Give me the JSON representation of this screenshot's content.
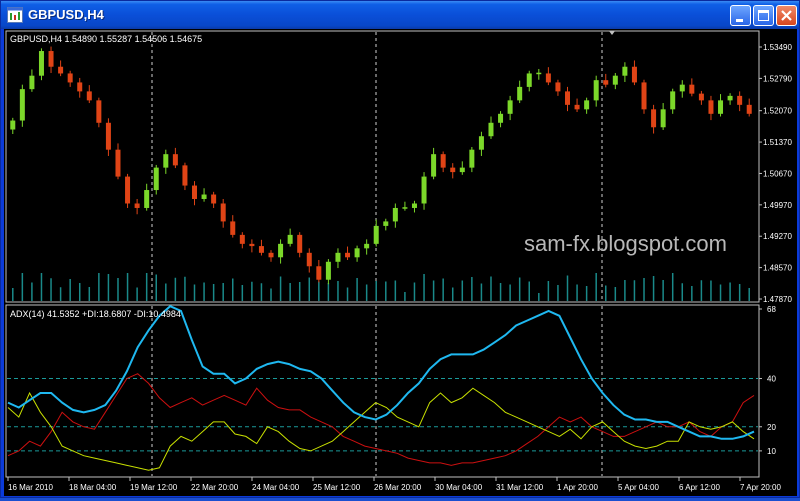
{
  "window": {
    "title": "GBPUSD,H4",
    "buttons": [
      "minimize",
      "maximize",
      "close"
    ]
  },
  "chart_data": [
    {
      "type": "candlestick",
      "title": "GBPUSD,H4  1.54890 1.55287 1.54506 1.54675",
      "symbol": "GBPUSD",
      "timeframe": "H4",
      "ohlc_header": {
        "open": "1.54890",
        "high": "1.55287",
        "low": "1.54506",
        "close": "1.54675"
      },
      "y_ticks": [
        "1.53490",
        "1.52790",
        "1.52070",
        "1.51370",
        "1.50670",
        "1.49970",
        "1.49270",
        "1.48570",
        "1.47870"
      ],
      "ylim": [
        1.4787,
        1.5349
      ],
      "close_path": [
        1.5185,
        1.5255,
        1.5285,
        1.534,
        1.5305,
        1.529,
        1.527,
        1.525,
        1.523,
        1.518,
        1.512,
        1.506,
        1.5,
        1.499,
        1.503,
        1.508,
        1.511,
        1.5085,
        1.504,
        1.501,
        1.502,
        1.5,
        1.496,
        1.493,
        1.491,
        1.4905,
        1.489,
        1.488,
        1.491,
        1.493,
        1.489,
        1.486,
        1.483,
        1.487,
        1.489,
        1.488,
        1.49,
        1.491,
        1.495,
        1.496,
        1.499,
        1.499,
        1.5,
        1.506,
        1.511,
        1.508,
        1.507,
        1.508,
        1.512,
        1.515,
        1.518,
        1.52,
        1.523,
        1.526,
        1.529,
        1.529,
        1.527,
        1.525,
        1.522,
        1.521,
        1.523,
        1.5275,
        1.5265,
        1.5285,
        1.5305,
        1.527,
        1.521,
        1.517,
        1.521,
        1.525,
        1.5265,
        1.5245,
        1.523,
        1.52,
        1.523,
        1.524,
        1.522,
        1.52
      ],
      "watermark": "sam-fx.blogspot.com"
    },
    {
      "type": "line",
      "title": "ADX(14) 41.5352 +DI:18.6807 -DI:10.4984",
      "indicator": "ADX(14)",
      "values": {
        "adx": "41.5352",
        "plus_di": "18.6807",
        "minus_di": "10.4984"
      },
      "y_ticks": [
        "68",
        "40",
        "20",
        "10"
      ],
      "levels": [
        40,
        20,
        10
      ],
      "ylim": [
        0,
        68
      ],
      "series": [
        {
          "name": "ADX",
          "color": "#1fb8f0",
          "values": [
            30,
            28,
            31,
            34,
            34,
            30,
            27,
            26,
            27,
            29,
            35,
            43,
            53,
            60,
            66,
            70,
            68,
            56,
            45,
            42,
            42,
            38,
            40,
            44,
            46,
            47,
            46,
            44,
            43,
            40,
            35,
            30,
            26,
            24,
            23,
            25,
            29,
            34,
            38,
            44,
            48,
            50,
            50,
            50,
            52,
            55,
            58,
            62,
            64,
            66,
            68,
            66,
            57,
            48,
            40,
            34,
            29,
            25,
            23,
            23,
            22,
            22,
            20,
            18,
            16,
            16,
            15,
            15,
            16,
            18
          ]
        },
        {
          "name": "+DI",
          "color": "#c8e000",
          "values": [
            28,
            24,
            34,
            26,
            20,
            12,
            10,
            8,
            7,
            6,
            5,
            4,
            3,
            2,
            3,
            12,
            16,
            14,
            18,
            22,
            22,
            17,
            16,
            13,
            20,
            18,
            14,
            11,
            10,
            12,
            14,
            18,
            22,
            26,
            30,
            28,
            24,
            22,
            20,
            30,
            34,
            30,
            32,
            36,
            33,
            30,
            26,
            24,
            22,
            20,
            18,
            16,
            19,
            15,
            20,
            22,
            18,
            14,
            12,
            11,
            12,
            14,
            14,
            22,
            20,
            19,
            20,
            22,
            18,
            15
          ]
        },
        {
          "name": "-DI",
          "color": "#cc1010",
          "values": [
            8,
            10,
            14,
            12,
            18,
            26,
            22,
            20,
            19,
            26,
            33,
            40,
            42,
            38,
            32,
            28,
            30,
            32,
            29,
            31,
            33,
            31,
            29,
            36,
            31,
            28,
            27,
            27,
            24,
            22,
            20,
            16,
            14,
            12,
            11,
            10,
            9,
            7,
            6,
            5,
            5,
            4,
            5,
            5,
            6,
            7,
            8,
            10,
            13,
            16,
            20,
            24,
            22,
            24,
            20,
            18,
            16,
            16,
            18,
            20,
            22,
            20,
            20,
            22,
            18,
            16,
            20,
            22,
            30,
            33
          ]
        }
      ]
    }
  ],
  "x_axis": {
    "labels": [
      "16 Mar 2010",
      "18 Mar 04:00",
      "19 Mar 12:00",
      "22 Mar 20:00",
      "24 Mar 04:00",
      "25 Mar 12:00",
      "26 Mar 20:00",
      "30 Mar 04:00",
      "31 Mar 12:00",
      "1 Apr 20:00",
      "5 Apr 04:00",
      "6 Apr 12:00",
      "7 Apr 20:00"
    ]
  },
  "colors": {
    "bull": "#7cd82a",
    "bear": "#e04416",
    "volume": "#1a8a8a",
    "grid": "#999999",
    "text": "#ffffff",
    "background": "#000000"
  }
}
